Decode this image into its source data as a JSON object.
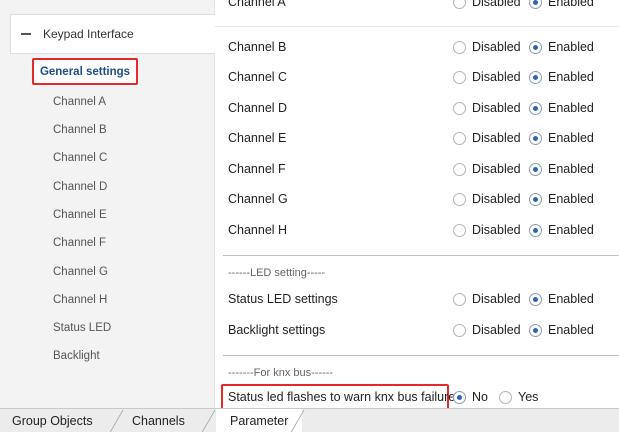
{
  "tree": {
    "root_label": "Keypad Interface",
    "items": [
      {
        "label": "General settings",
        "selected": true
      },
      {
        "label": "Channel A"
      },
      {
        "label": "Channel B"
      },
      {
        "label": "Channel C"
      },
      {
        "label": "Channel D"
      },
      {
        "label": "Channel E"
      },
      {
        "label": "Channel F"
      },
      {
        "label": "Channel G"
      },
      {
        "label": "Channel H"
      },
      {
        "label": "Status LED"
      },
      {
        "label": "Backlight"
      }
    ]
  },
  "params": {
    "partial_row": {
      "label": "Channel A",
      "opt_disabled": "Disabled",
      "opt_enabled": "Enabled"
    },
    "rows": [
      {
        "label": "Channel B",
        "opt_disabled": "Disabled",
        "opt_enabled": "Enabled",
        "value": "Enabled"
      },
      {
        "label": "Channel C",
        "opt_disabled": "Disabled",
        "opt_enabled": "Enabled",
        "value": "Enabled"
      },
      {
        "label": "Channel D",
        "opt_disabled": "Disabled",
        "opt_enabled": "Enabled",
        "value": "Enabled"
      },
      {
        "label": "Channel E",
        "opt_disabled": "Disabled",
        "opt_enabled": "Enabled",
        "value": "Enabled"
      },
      {
        "label": "Channel F",
        "opt_disabled": "Disabled",
        "opt_enabled": "Enabled",
        "value": "Enabled"
      },
      {
        "label": "Channel G",
        "opt_disabled": "Disabled",
        "opt_enabled": "Enabled",
        "value": "Enabled"
      },
      {
        "label": "Channel H",
        "opt_disabled": "Disabled",
        "opt_enabled": "Enabled",
        "value": "Enabled"
      }
    ],
    "led_section": "------LED setting-----",
    "led_rows": [
      {
        "label": "Status LED settings",
        "opt_disabled": "Disabled",
        "opt_enabled": "Enabled",
        "value": "Enabled"
      },
      {
        "label": "Backlight settings",
        "opt_disabled": "Disabled",
        "opt_enabled": "Enabled",
        "value": "Enabled"
      }
    ],
    "bus_section": "-------For knx bus------",
    "bus_row": {
      "label": "Status led flashes to warn knx bus failure",
      "opt_no": "No",
      "opt_yes": "Yes",
      "value": "No"
    }
  },
  "tabs": [
    {
      "label": "Group Objects"
    },
    {
      "label": "Channels"
    },
    {
      "label": "Parameter",
      "active": true
    }
  ],
  "colors": {
    "highlight": "#e22a2a",
    "selected_text": "#1e4e8a",
    "radio_on": "#2f64b3"
  }
}
